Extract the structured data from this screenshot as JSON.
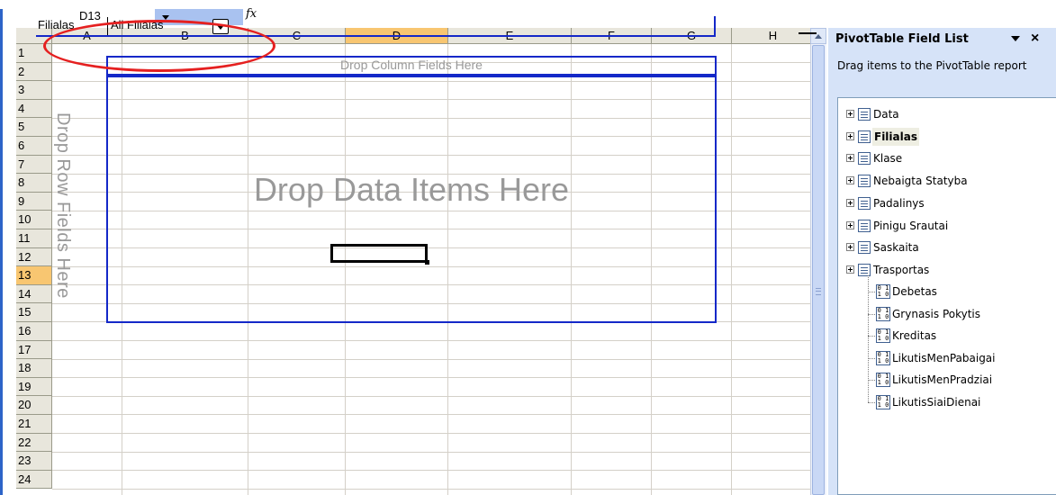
{
  "formula_bar": {
    "name_box": "D13",
    "fx_icon": "fx-icon"
  },
  "columns": [
    "A",
    "B",
    "C",
    "D",
    "E",
    "F",
    "G",
    "H"
  ],
  "selected_column": "D",
  "rows": [
    "1",
    "2",
    "3",
    "4",
    "5",
    "6",
    "7",
    "8",
    "9",
    "10",
    "11",
    "12",
    "13",
    "14",
    "15",
    "16",
    "17",
    "18",
    "19",
    "20",
    "21",
    "22",
    "23",
    "24"
  ],
  "selected_row": "13",
  "pivot": {
    "page_field_label": "Filialas",
    "page_field_value": "All Filialas",
    "column_drop": "Drop Column Fields Here",
    "row_drop": "Drop Row Fields Here",
    "data_drop": "Drop Data Items Here"
  },
  "task_pane": {
    "title": "PivotTable Field List",
    "description": "Drag items to the PivotTable report",
    "dimension_fields": [
      "Data",
      "Filialas",
      "Klase",
      "Nebaigta Statyba",
      "Padalinys",
      "Pinigu Srautai",
      "Saskaita",
      "Trasportas"
    ],
    "measure_fields": [
      "Debetas",
      "Grynasis Pokytis",
      "Kreditas",
      "LikutisMenPabaigai",
      "LikutisMenPradziai",
      "LikutisSiaiDienai"
    ],
    "selected_field": "Filialas",
    "measure_icon_text": "0 1\n1 0"
  },
  "colors": {
    "pivot_border": "#1428c8",
    "annotation_oval": "#e52020",
    "selected_header": "#f8c671",
    "pane_background": "#d6e3f8"
  }
}
